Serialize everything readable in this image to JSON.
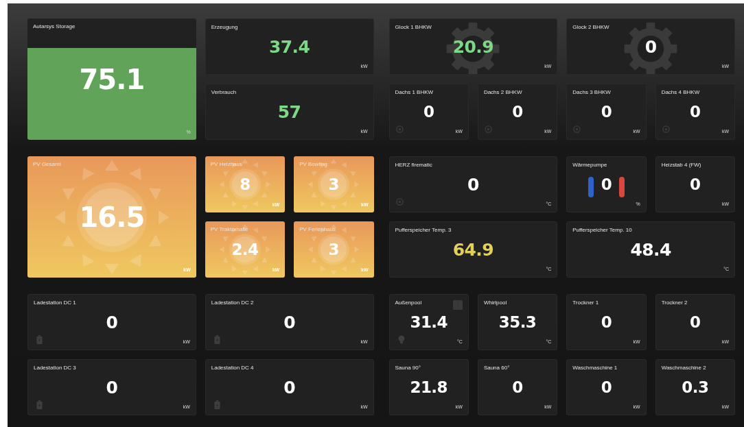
{
  "sections": [
    {
      "tiles": [
        {
          "title": "Autarsys Storage",
          "value": "75.1",
          "unit": "%",
          "kind": "storage"
        },
        {
          "title": "Erzeugung",
          "value": "37.4",
          "unit": "kW",
          "kind": "wide",
          "color": "#7dd887"
        },
        {
          "title": "Verbrauch",
          "value": "57",
          "unit": "kW",
          "kind": "wide",
          "color": "#7dd887"
        }
      ]
    },
    {
      "tiles": [
        {
          "title": "Glock 1 BHKW",
          "value": "20.9",
          "unit": "kW",
          "kind": "generator",
          "color": "#7dd887"
        },
        {
          "title": "Glock 2 BHKW",
          "value": "0",
          "unit": "kW",
          "kind": "generator"
        },
        {
          "title": "Dachs 1 BHKW",
          "value": "0",
          "unit": "kW",
          "kind": "engine"
        },
        {
          "title": "Dachs 2 BHKW",
          "value": "0",
          "unit": "kW",
          "kind": "engine"
        },
        {
          "title": "Dachs 3 BHKW",
          "value": "0",
          "unit": "kW",
          "kind": "engine"
        },
        {
          "title": "Dachs 4 BHKW",
          "value": "0",
          "unit": "kW",
          "kind": "engine"
        }
      ]
    },
    {
      "tiles": [
        {
          "title": "PV Gesamt",
          "value": "16.5",
          "unit": "kW",
          "kind": "solarfield"
        },
        {
          "title": "PV Heizhaus",
          "value": "8",
          "unit": "kW",
          "kind": "solar"
        },
        {
          "title": "PV Bowling",
          "value": "3",
          "unit": "kW",
          "kind": "solar"
        },
        {
          "title": "PV Traktorhalle",
          "value": "2.4",
          "unit": "kW",
          "kind": "solar"
        },
        {
          "title": "PV Ferienhaus",
          "value": "3",
          "unit": "kW",
          "kind": "solar"
        }
      ]
    },
    {
      "tiles": [
        {
          "title": "HERZ firematic",
          "value": "0",
          "unit": "°C",
          "kind": "boiler"
        },
        {
          "title": "Wärmepumpe",
          "value": "0",
          "unit": "%",
          "kind": "heatpump"
        },
        {
          "title": "Heizstab 4 (FW)",
          "value": "0",
          "unit": "kW",
          "kind": "small"
        },
        {
          "title": "Pufferspeicher Temp. 3",
          "value": "64.9",
          "unit": "°C",
          "kind": "wide",
          "color": "#e3d05a"
        },
        {
          "title": "Pufferspeicher Temp. 10",
          "value": "48.4",
          "unit": "°C",
          "kind": "wide"
        }
      ]
    },
    {
      "tiles": [
        {
          "title": "Ladestation DC 1",
          "value": "0",
          "unit": "kW",
          "kind": "charger"
        },
        {
          "title": "Ladestation DC 2",
          "value": "0",
          "unit": "kW",
          "kind": "charger"
        },
        {
          "title": "Ladestation DC 3",
          "value": "0",
          "unit": "kW",
          "kind": "charger"
        },
        {
          "title": "Ladestation DC 4",
          "value": "0",
          "unit": "kW",
          "kind": "charger"
        }
      ]
    },
    {
      "tiles": [
        {
          "title": "Außenpool",
          "value": "31.4",
          "unit": "°C",
          "kind": "pool"
        },
        {
          "title": "Whirlpool",
          "value": "35.3",
          "unit": "°C",
          "kind": "small"
        },
        {
          "title": "Trockner 1",
          "value": "0",
          "unit": "kW",
          "kind": "small"
        },
        {
          "title": "Trockner 2",
          "value": "0",
          "unit": "kW",
          "kind": "small"
        },
        {
          "title": "Sauna 90°",
          "value": "21.8",
          "unit": "kW",
          "kind": "small"
        },
        {
          "title": "Sauna 60°",
          "value": "0",
          "unit": "kW",
          "kind": "small"
        },
        {
          "title": "Waschmaschine 1",
          "value": "0",
          "unit": "kW",
          "kind": "small"
        },
        {
          "title": "Waschmaschine 2",
          "value": "0.3",
          "unit": "kW",
          "kind": "small"
        }
      ]
    }
  ]
}
